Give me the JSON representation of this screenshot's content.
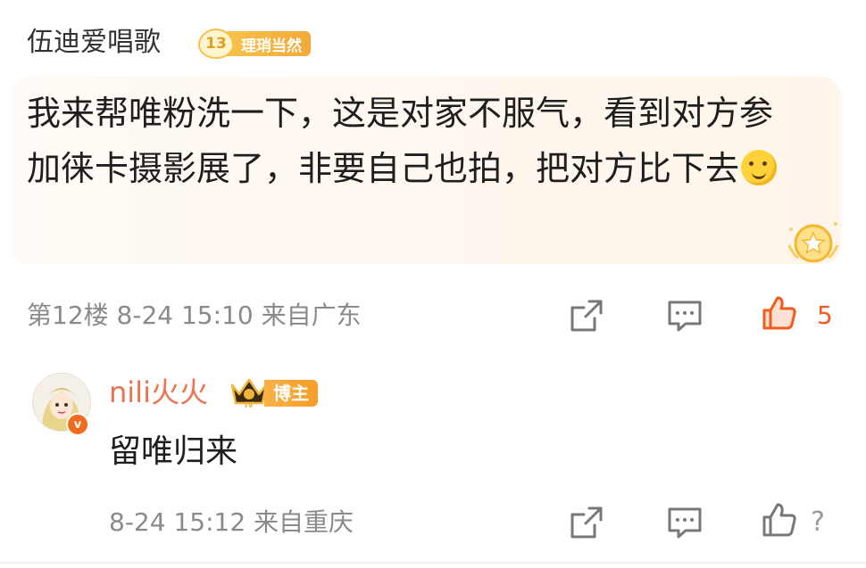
{
  "top_comment": {
    "username": "伍迪爱唱歌",
    "fan_badge": {
      "level": "13",
      "name": "理琑当然"
    },
    "text": "我来帮唯粉洗一下，这是对家不服气，看到对方参加徕卡摄影展了，非要自己也拍，把对方比下去",
    "emoji": "thinking-emoji",
    "floor": "第12楼",
    "datetime": "8-24 15:10",
    "location": "来自广东",
    "like_count": "5"
  },
  "reply": {
    "username": "nili火火",
    "vip_level": "IV",
    "badge": "博主",
    "verified_mark": "v",
    "text": "留唯归来",
    "datetime": "8-24 15:12",
    "location": "来自重庆",
    "trailing": "?"
  },
  "colors": {
    "username_reply": "#eb7350",
    "like_active": "#f25a1f",
    "meta_text": "#8a8a8a",
    "badge_gold": "#f7c24a"
  },
  "icons": [
    "share-icon",
    "comment-icon",
    "like-icon",
    "medal-icon",
    "vip-crown-icon",
    "thinking-emoji"
  ]
}
